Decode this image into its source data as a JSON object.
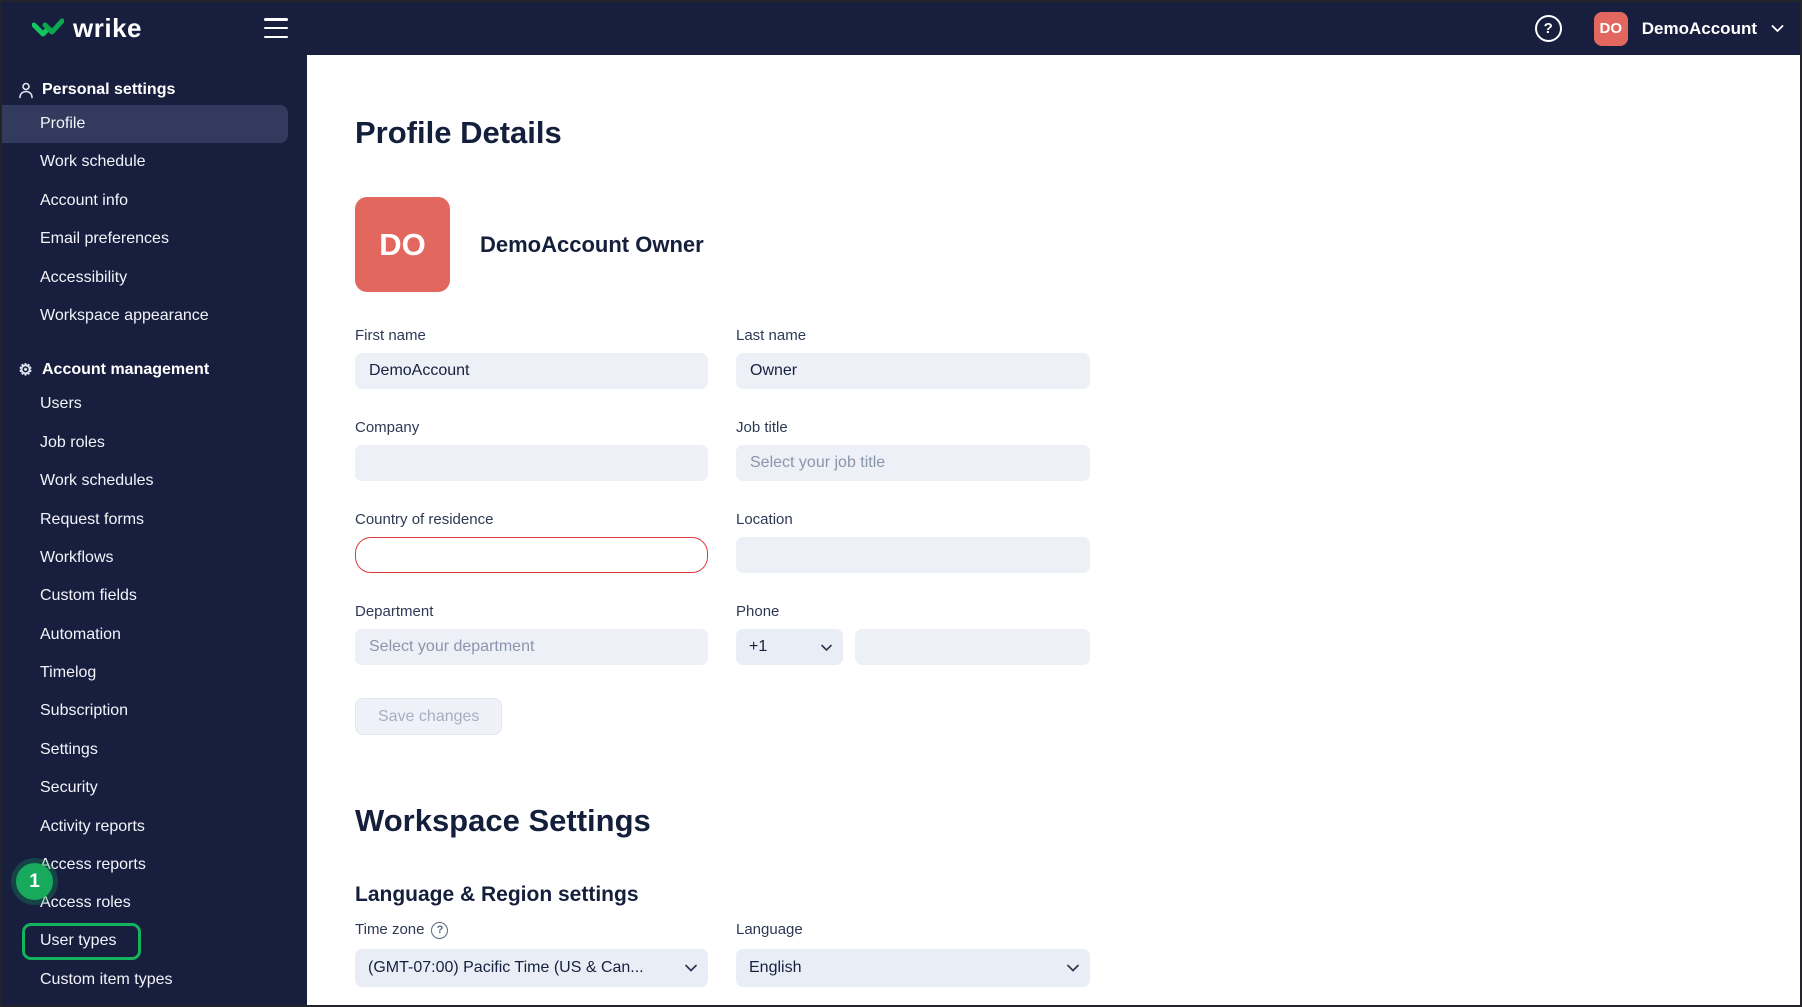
{
  "topbar": {
    "brand": "wrike",
    "avatar_initials": "DO",
    "account_name": "DemoAccount",
    "help_glyph": "?"
  },
  "sidebar": {
    "annotation_badge": "1",
    "sections": [
      {
        "title": "Personal settings",
        "items": [
          {
            "label": "Profile"
          },
          {
            "label": "Work schedule"
          },
          {
            "label": "Account info"
          },
          {
            "label": "Email preferences"
          },
          {
            "label": "Accessibility"
          },
          {
            "label": "Workspace appearance"
          }
        ]
      },
      {
        "title": "Account management",
        "items": [
          {
            "label": "Users"
          },
          {
            "label": "Job roles"
          },
          {
            "label": "Work schedules"
          },
          {
            "label": "Request forms"
          },
          {
            "label": "Workflows"
          },
          {
            "label": "Custom fields"
          },
          {
            "label": "Automation"
          },
          {
            "label": "Timelog"
          },
          {
            "label": "Subscription"
          },
          {
            "label": "Settings"
          },
          {
            "label": "Security"
          },
          {
            "label": "Activity reports"
          },
          {
            "label": "Access reports"
          },
          {
            "label": "Access roles"
          },
          {
            "label": "User types"
          },
          {
            "label": "Custom item types"
          }
        ]
      }
    ]
  },
  "profile": {
    "title": "Profile Details",
    "avatar_initials": "DO",
    "full_name": "DemoAccount Owner",
    "fields": {
      "first_name": {
        "label": "First name",
        "value": "DemoAccount"
      },
      "last_name": {
        "label": "Last name",
        "value": "Owner"
      },
      "company": {
        "label": "Company",
        "value": ""
      },
      "job_title": {
        "label": "Job title",
        "placeholder": "Select your job title"
      },
      "country": {
        "label": "Country of residence",
        "value": ""
      },
      "location": {
        "label": "Location",
        "value": ""
      },
      "department": {
        "label": "Department",
        "placeholder": "Select your department"
      },
      "phone": {
        "label": "Phone",
        "code": "+1",
        "value": ""
      }
    },
    "save_button": "Save changes"
  },
  "workspace": {
    "title": "Workspace Settings",
    "language_region_title": "Language & Region settings",
    "timezone": {
      "label": "Time zone",
      "help_glyph": "?",
      "value": "(GMT-07:00) Pacific Time (US & Can..."
    },
    "language": {
      "label": "Language",
      "value": "English"
    }
  },
  "colors": {
    "sidebar_bg": "#171e3e",
    "accent_green": "#14b25c",
    "avatar_coral": "#e2685f",
    "error_red": "#dd3b3b"
  }
}
